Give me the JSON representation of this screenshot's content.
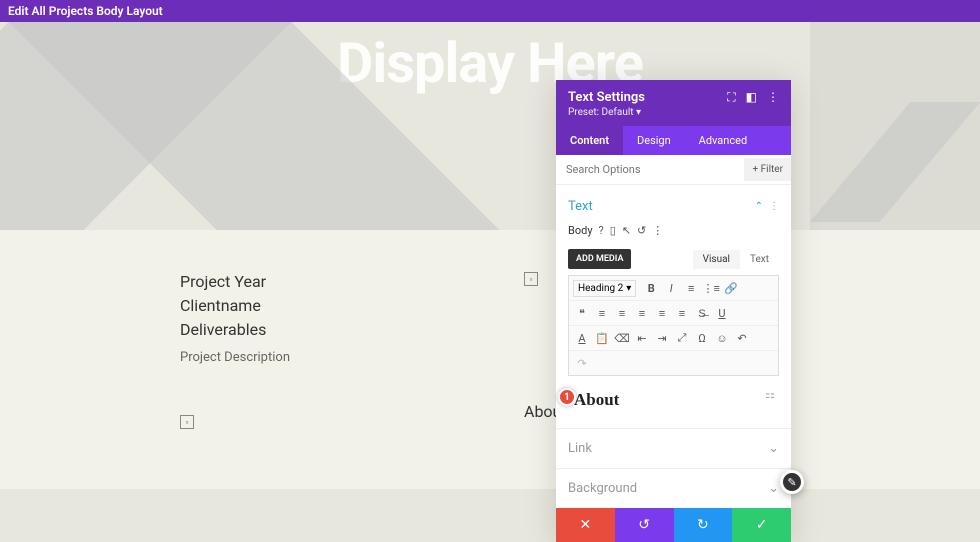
{
  "topbar": {
    "title": "Edit All Projects Body Layout"
  },
  "hero": {
    "title": "Display Here"
  },
  "project": {
    "year": "Project Year",
    "client": "Clientname",
    "deliverables": "Deliverables",
    "description": "Project Description"
  },
  "about_label": "About",
  "modal": {
    "title": "Text Settings",
    "preset": "Preset: Default",
    "tabs": {
      "content": "Content",
      "design": "Design",
      "advanced": "Advanced"
    },
    "search_placeholder": "Search Options",
    "filter": "Filter",
    "text_section": "Text",
    "body_label": "Body",
    "add_media": "ADD MEDIA",
    "visual": "Visual",
    "text_tab": "Text",
    "heading_sel": "Heading 2",
    "editor_content": "About",
    "marker": "1",
    "link_section": "Link",
    "bg_section": "Background"
  }
}
